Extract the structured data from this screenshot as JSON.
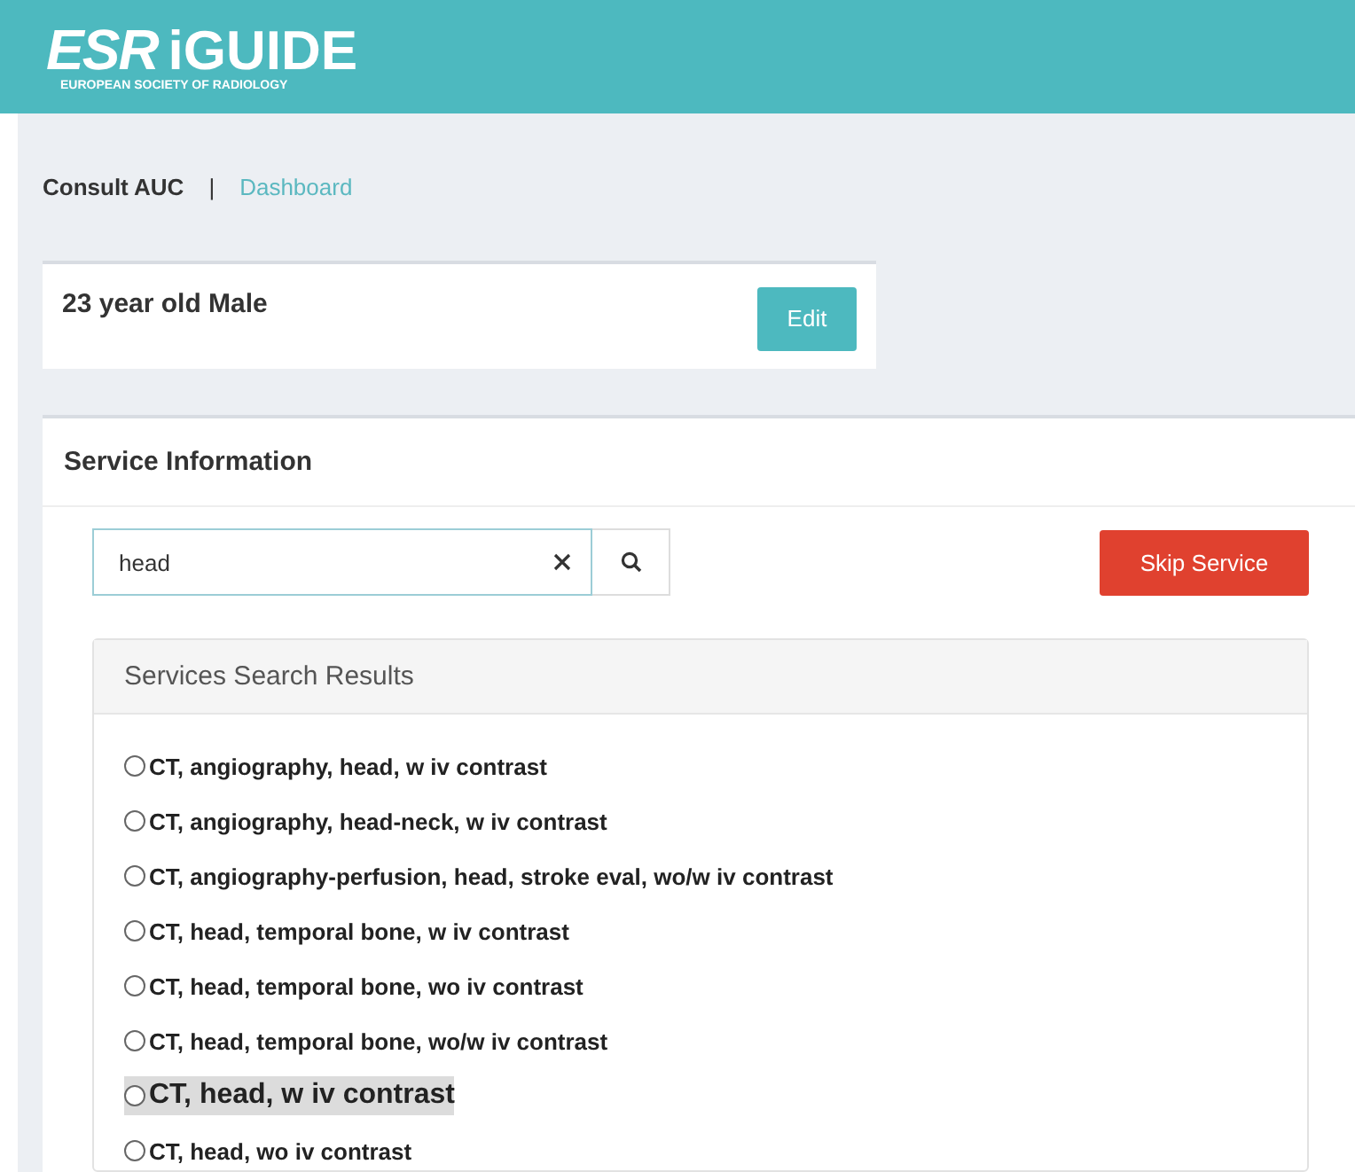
{
  "header": {
    "logo_mark": "ESR",
    "logo_name": "iGUIDE",
    "logo_tagline": "EUROPEAN SOCIETY OF RADIOLOGY"
  },
  "breadcrumb": [
    {
      "label": "Consult AUC",
      "selected": true
    },
    {
      "label": "Dashboard",
      "selected": false
    }
  ],
  "breadcrumb_separator": "|",
  "patient": {
    "summary": "23 year old Male",
    "edit_button": "Edit"
  },
  "service": {
    "title": "Service Information",
    "search": {
      "value": "head"
    },
    "skip_button": "Skip Service",
    "results": {
      "title": "Services Search Results",
      "items": [
        {
          "label": "CT, angiography, head, w iv contrast",
          "selected": false,
          "highlighted": false
        },
        {
          "label": "CT, angiography, head-neck, w iv contrast",
          "selected": false,
          "highlighted": false
        },
        {
          "label": "CT, angiography-perfusion, head, stroke eval, wo/w iv contrast",
          "selected": false,
          "highlighted": false
        },
        {
          "label": "CT, head, temporal bone, w iv contrast",
          "selected": false,
          "highlighted": false
        },
        {
          "label": "CT, head, temporal bone, wo iv contrast",
          "selected": false,
          "highlighted": false
        },
        {
          "label": "CT, head, temporal bone, wo/w iv contrast",
          "selected": false,
          "highlighted": false
        },
        {
          "label": "CT, head, w iv contrast",
          "selected": false,
          "highlighted": true
        },
        {
          "label": "CT, head, wo iv contrast",
          "selected": false,
          "highlighted": false
        }
      ]
    }
  }
}
